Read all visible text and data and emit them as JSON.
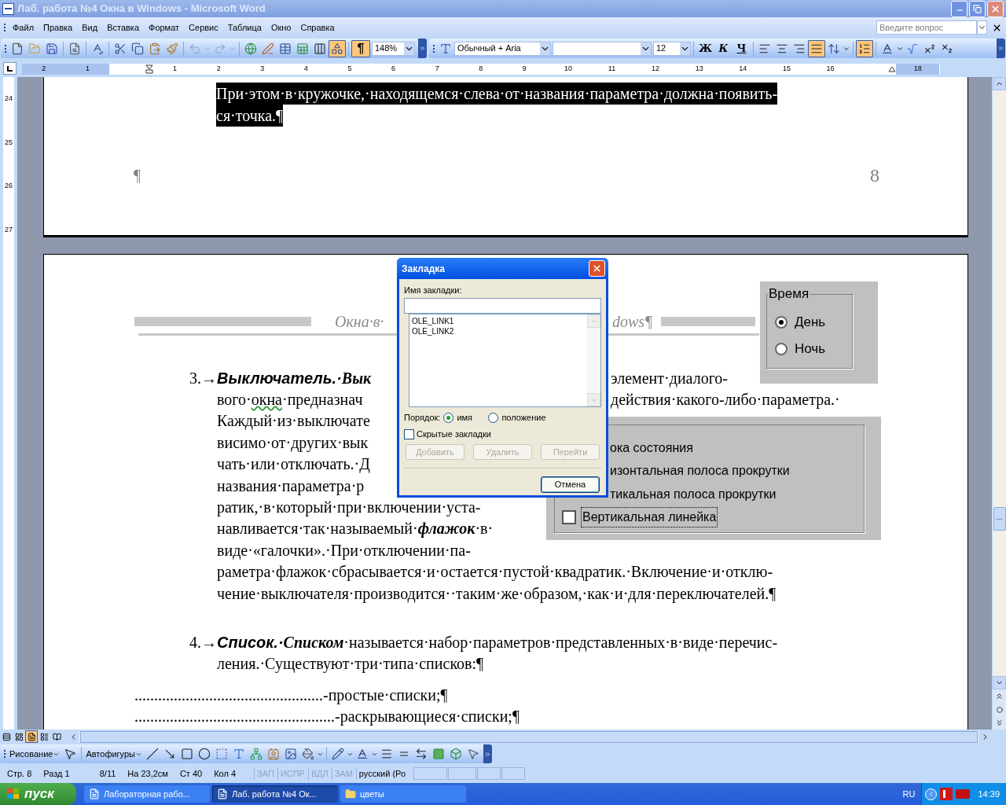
{
  "window": {
    "title": "Лаб. работа №4 Окна в Windows - Microsoft Word"
  },
  "menu": {
    "items": [
      "Файл",
      "Правка",
      "Вид",
      "Вставка",
      "Формат",
      "Сервис",
      "Таблица",
      "Окно",
      "Справка"
    ],
    "help_placeholder": "Введите вопрос"
  },
  "standard_toolbar": {
    "drawing_on": true,
    "formatting_marks": {
      "label": "¶",
      "on": true
    },
    "zoom": "148%"
  },
  "formatting_toolbar": {
    "style": "Обычный + Aria",
    "font_size": "12",
    "justify_on": true,
    "numbering_on": true,
    "text_styles": [
      {
        "label": "Ж",
        "on": false
      },
      {
        "label": "К",
        "on": false
      },
      {
        "label": "Ч",
        "on": false
      }
    ]
  },
  "ruler": {
    "left_labels": [
      "2",
      "1"
    ],
    "labels": [
      "1",
      "2",
      "3",
      "4",
      "5",
      "6",
      "7",
      "8",
      "9",
      "10",
      "11",
      "12",
      "13",
      "14",
      "15",
      "16"
    ],
    "right_labels": [
      "18"
    ]
  },
  "vertical_ruler": {
    "labels": [
      "24",
      "25",
      "26",
      "27"
    ]
  },
  "page_1": {
    "selected_lines": [
      "При·этом·в·кружочке,·находящемся·слева·от·названия·параметра·должна·появить-",
      "ся·точка.¶"
    ],
    "paragraph_mark": "¶",
    "page_number": "8"
  },
  "page_2": {
    "header": {
      "left": "Окна·в·",
      "right": "dows¶"
    },
    "figure_time": {
      "title": "Время",
      "options": [
        {
          "label": "День",
          "selected": true
        },
        {
          "label": "Ночь",
          "selected": false
        }
      ]
    },
    "figure_options": {
      "items": [
        {
          "label": "ока состояния"
        },
        {
          "label": "изонтальная полоса прокрутки"
        },
        {
          "label": "тикальная полоса прокрутки"
        },
        {
          "label": "Вертикальная линейка",
          "checked": false,
          "focused": true
        }
      ]
    },
    "paragraphs": [
      {
        "number": "3.→",
        "lines": [
          {
            "parts": [
              {
                "text": "Выключатель.·",
                "kind": "term"
              },
              {
                "text": "Вык",
                "kind": "emphasis"
              }
            ],
            "right": "элемент·диалого-"
          },
          {
            "parts": [
              {
                "text": "вого·"
              },
              {
                "text": "окна",
                "kind": "misspelled"
              },
              {
                "text": "·предназнач"
              }
            ],
            "right": "действия·какого-либо·параметра.·"
          },
          {
            "parts": [
              {
                "text": "Каждый·из·выключате"
              }
            ]
          },
          {
            "parts": [
              {
                "text": "висимо·от·других·вык"
              }
            ]
          },
          {
            "parts": [
              {
                "text": "чать·или·отключать.·Д"
              }
            ]
          },
          {
            "parts": [
              {
                "text": "названия·параметра·р"
              }
            ]
          },
          {
            "parts": [
              {
                "text": "ратик,·в·который·при·включении·уста-"
              }
            ]
          },
          {
            "parts": [
              {
                "text": "навливается·так·называемый·"
              },
              {
                "text": "флажок",
                "kind": "emphasis"
              },
              {
                "text": "·в·"
              }
            ]
          },
          {
            "parts": [
              {
                "text": "виде·«галочки».·При·отключении·па-"
              }
            ]
          },
          {
            "parts": [
              {
                "text": "раметра·флажок·сбрасывается·и·остается·пустой·квадратик.·Включение·и·отклю-"
              }
            ]
          },
          {
            "parts": [
              {
                "text": "чение·выключателя·производится··таким·же·образом,·как·и·для·переключателей.¶"
              }
            ]
          }
        ]
      },
      {
        "number": "4.→",
        "lines": [
          {
            "parts": [
              {
                "text": "Список.·",
                "kind": "term"
              },
              {
                "text": "Списком",
                "kind": "emphasis"
              },
              {
                "text": "·называется·набор·параметров·представленных·в·виде·перечис-"
              }
            ]
          },
          {
            "parts": [
              {
                "text": "ления.·Существуют·три·типа·списков:¶"
              }
            ]
          }
        ]
      }
    ],
    "leader_lines": [
      {
        "leader": "................................................",
        "text": "-простые·списки;¶"
      },
      {
        "leader": "...................................................",
        "text": "-раскрывающиеся·списки;¶"
      }
    ]
  },
  "dialog": {
    "title": "Закладка",
    "name_label": "Имя закладки:",
    "bookmarks": [
      "OLE_LINK1",
      "OLE_LINK2"
    ],
    "order_label": "Порядок:",
    "order_options": [
      {
        "label": "имя",
        "selected": true
      },
      {
        "label": "положение",
        "selected": false
      }
    ],
    "hidden_bookmarks": {
      "label": "Скрытые закладки",
      "checked": false
    },
    "buttons": [
      {
        "label": "Добавить",
        "disabled": true
      },
      {
        "label": "Удалить",
        "disabled": true
      },
      {
        "label": "Перейти",
        "disabled": true
      }
    ],
    "cancel": "Отмена"
  },
  "print_layout_view_on": true,
  "drawing_toolbar": {
    "draw_menu": "Рисование",
    "autoshapes": "Автофигуры"
  },
  "status_bar": {
    "fields": [
      "Стр. 8",
      "Разд 1",
      "8/11",
      "На 23,2см",
      "Ст 40",
      "Кол 4"
    ],
    "indicators": [
      {
        "label": "ЗАП",
        "on": false
      },
      {
        "label": "ИСПР",
        "on": false
      },
      {
        "label": "ВДЛ",
        "on": false
      },
      {
        "label": "ЗАМ",
        "on": false
      }
    ],
    "language": "русский (Ро"
  },
  "taskbar": {
    "start": "пуск",
    "tasks": [
      {
        "label": "Лабораторная рабо...",
        "kind": "word",
        "selected": false
      },
      {
        "label": "Лаб. работа №4 Ок...",
        "kind": "word",
        "selected": true
      },
      {
        "label": "цветы",
        "kind": "folder",
        "selected": false
      }
    ],
    "language": "RU",
    "clock": "14:39"
  }
}
